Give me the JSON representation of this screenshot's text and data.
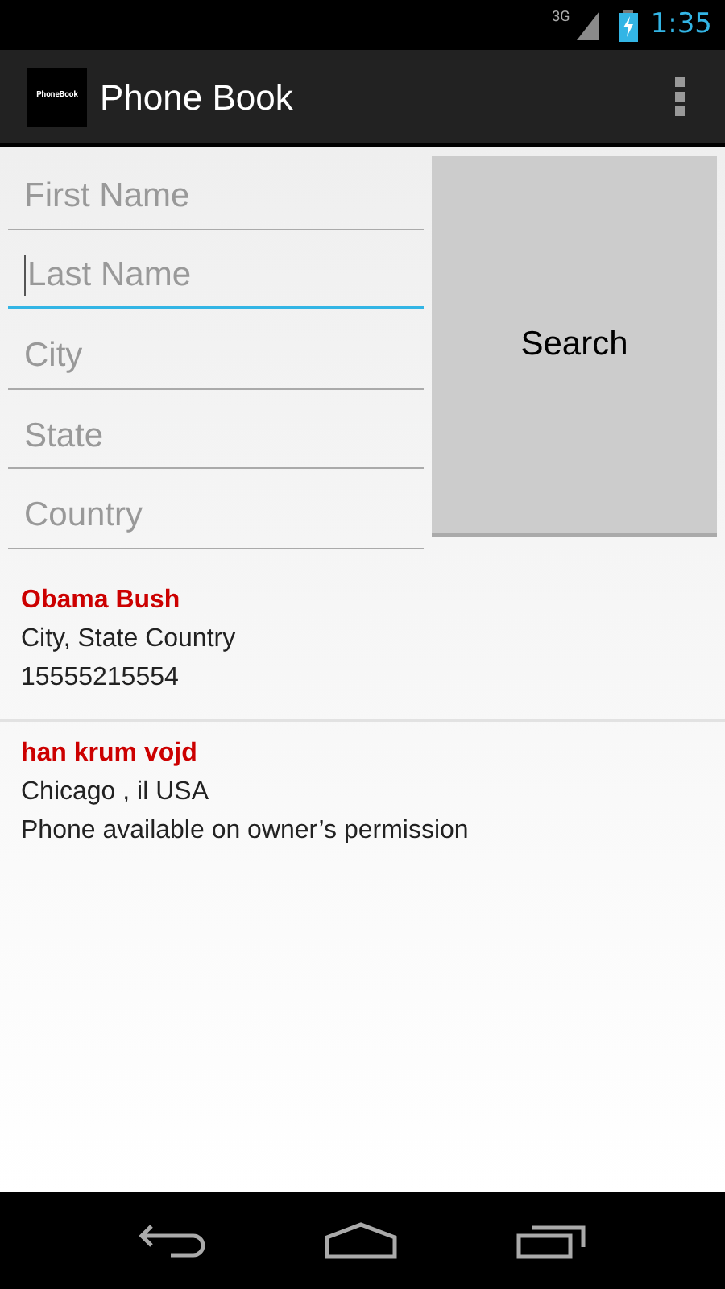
{
  "status_bar": {
    "network": "3G",
    "time": "1:35"
  },
  "action_bar": {
    "logo_text": "PhoneBook",
    "title": "Phone Book"
  },
  "fields": [
    {
      "placeholder": "First Name",
      "focused": false
    },
    {
      "placeholder": "Last Name",
      "focused": true
    },
    {
      "placeholder": "City",
      "focused": false
    },
    {
      "placeholder": "State",
      "focused": false
    },
    {
      "placeholder": "Country",
      "focused": false
    }
  ],
  "search_button": "Search",
  "results": [
    {
      "name": "Obama Bush",
      "address": "City, State Country",
      "phone": "15555215554"
    },
    {
      "name": "han krum vojd",
      "address": "Chicago , il USA",
      "phone": "Phone available on owner’s permission"
    }
  ]
}
